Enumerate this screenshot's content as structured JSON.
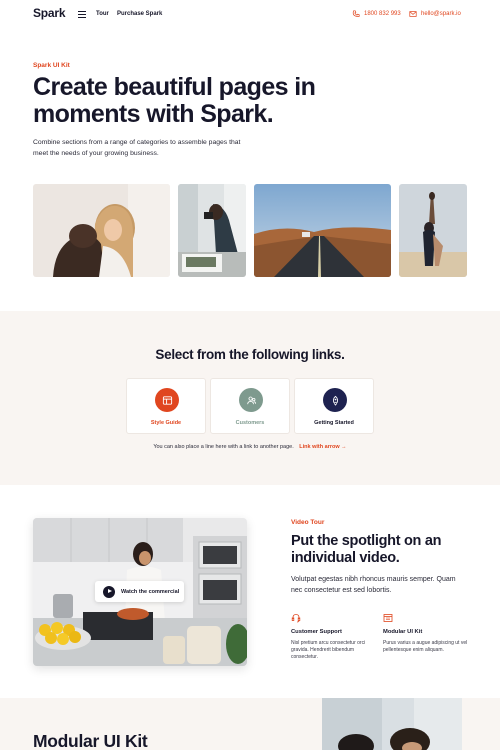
{
  "brand": {
    "logo": "Spark",
    "accent": "#e0461f",
    "dark": "#17172a"
  },
  "nav": {
    "links": [
      "Tour",
      "Purchase Spark"
    ],
    "phone": "1800 832 993",
    "email": "hello@spark.io"
  },
  "hero": {
    "eyebrow": "Spark UI Kit",
    "title": "Create beautiful pages in moments with Spark.",
    "subtitle": "Combine sections from a range of categories to assemble pages that meet the needs of your growing business."
  },
  "links_section": {
    "title": "Select from the following links.",
    "cards": [
      {
        "label": "Style Guide",
        "icon": "layout-icon",
        "circle": "#e0461f",
        "text_color": "#e0461f"
      },
      {
        "label": "Customers",
        "icon": "users-icon",
        "circle": "#7e9a8e",
        "text_color": "#7e9a8e"
      },
      {
        "label": "Getting Started",
        "icon": "rocket-icon",
        "circle": "#1e2250",
        "text_color": "#17172a"
      }
    ],
    "note": "You can also place a line here with a link to another page.",
    "note_link": "Link with arrow →"
  },
  "video_section": {
    "eyebrow": "Video Tour",
    "title": "Put the spotlight on an individual video.",
    "subtitle": "Volutpat egestas nibh rhoncus mauris semper. Quam nec consectetur est sed lobortis.",
    "watch_label": "Watch the commercial",
    "features": [
      {
        "title": "Customer Support",
        "desc": "Nisl pretium arcu consectetur orci gravida. Hendrerit bibendum consectetur.",
        "icon": "headset-icon"
      },
      {
        "title": "Modular UI Kit",
        "desc": "Purus varius a augue adipiscing ut vel pellentesque enim aliquam.",
        "icon": "browser-icon"
      }
    ]
  },
  "bottom_section": {
    "title": "Modular UI Kit"
  }
}
